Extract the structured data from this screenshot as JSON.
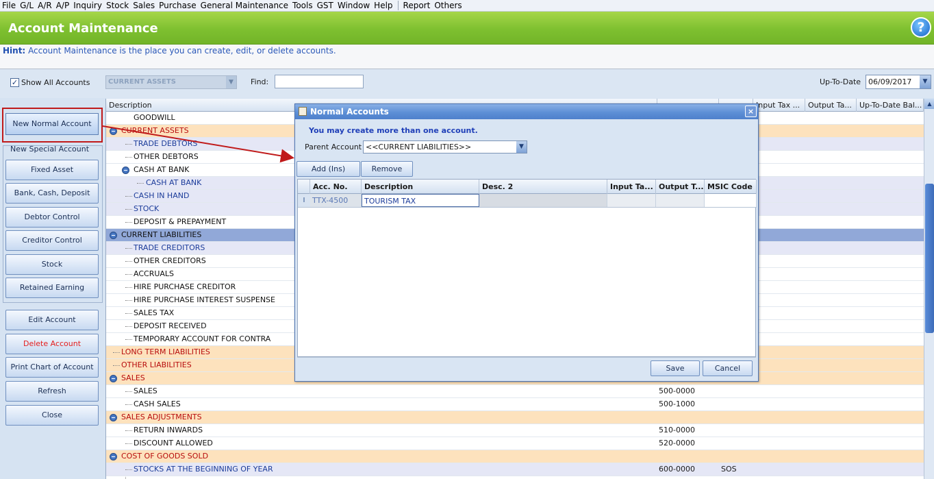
{
  "menu": [
    "File",
    "G/L",
    "A/R",
    "A/P",
    "Inquiry",
    "Stock",
    "Sales",
    "Purchase",
    "General Maintenance",
    "Tools",
    "GST",
    "Window",
    "Help",
    "Report",
    "Others"
  ],
  "header": {
    "title": "Account Maintenance",
    "help": "?"
  },
  "hint": {
    "label": "Hint:",
    "text": "Account Maintenance is the place you can create, edit, or delete accounts."
  },
  "filter": {
    "show_all_label": "Show All Accounts",
    "show_all_checked": "✓",
    "category_value": "CURRENT ASSETS",
    "find_label": "Find:",
    "find_value": "",
    "uptodate_label": "Up-To-Date",
    "uptodate_value": "06/09/2017"
  },
  "left_buttons": {
    "new_normal": "New Normal Account",
    "new_special": "New Special Account",
    "fixed_asset": "Fixed Asset",
    "bank_cash": "Bank, Cash, Deposit",
    "debtor_control": "Debtor Control",
    "creditor_control": "Creditor Control",
    "stock": "Stock",
    "retained_earning": "Retained Earning",
    "edit": "Edit Account",
    "delete": "Delete Account",
    "print": "Print Chart of Account",
    "refresh": "Refresh",
    "close": "Close"
  },
  "grid": {
    "headers": {
      "description": "Description",
      "input_tax": "Input Tax ...",
      "output_tax": "Output Ta...",
      "utd_balance": "Up-To-Date Bal..."
    },
    "rows": [
      {
        "text": "GOODWILL",
        "code": "",
        "msic": ""
      },
      {
        "text": "CURRENT ASSETS",
        "code": "",
        "msic": ""
      },
      {
        "text": "TRADE DEBTORS",
        "code": "",
        "msic": ""
      },
      {
        "text": "OTHER DEBTORS",
        "code": "",
        "msic": ""
      },
      {
        "text": "CASH AT BANK",
        "code": "",
        "msic": ""
      },
      {
        "text": "CASH AT BANK",
        "code": "",
        "msic": ""
      },
      {
        "text": "CASH IN HAND",
        "code": "",
        "msic": ""
      },
      {
        "text": "STOCK",
        "code": "",
        "msic": ""
      },
      {
        "text": "DEPOSIT & PREPAYMENT",
        "code": "",
        "msic": ""
      },
      {
        "text": "CURRENT LIABILITIES",
        "code": "",
        "msic": ""
      },
      {
        "text": "TRADE CREDITORS",
        "code": "",
        "msic": ""
      },
      {
        "text": "OTHER CREDITORS",
        "code": "",
        "msic": ""
      },
      {
        "text": "ACCRUALS",
        "code": "",
        "msic": ""
      },
      {
        "text": "HIRE PURCHASE CREDITOR",
        "code": "",
        "msic": ""
      },
      {
        "text": "HIRE PURCHASE INTEREST SUSPENSE",
        "code": "",
        "msic": ""
      },
      {
        "text": "SALES TAX",
        "code": "",
        "msic": ""
      },
      {
        "text": "DEPOSIT RECEIVED",
        "code": "",
        "msic": ""
      },
      {
        "text": "TEMPORARY ACCOUNT FOR CONTRA",
        "code": "",
        "msic": ""
      },
      {
        "text": "LONG TERM LIABILITIES",
        "code": "",
        "msic": ""
      },
      {
        "text": "OTHER LIABILITIES",
        "code": "",
        "msic": ""
      },
      {
        "text": "SALES",
        "code": "",
        "msic": ""
      },
      {
        "text": "SALES",
        "code": "500-0000",
        "msic": ""
      },
      {
        "text": "CASH SALES",
        "code": "500-1000",
        "msic": ""
      },
      {
        "text": "SALES ADJUSTMENTS",
        "code": "",
        "msic": ""
      },
      {
        "text": "RETURN INWARDS",
        "code": "510-0000",
        "msic": ""
      },
      {
        "text": "DISCOUNT ALLOWED",
        "code": "520-0000",
        "msic": ""
      },
      {
        "text": "COST OF GOODS SOLD",
        "code": "",
        "msic": ""
      },
      {
        "text": "STOCKS AT THE BEGINNING OF YEAR",
        "code": "600-0000",
        "msic": "SOS"
      }
    ]
  },
  "dialog": {
    "title": "Normal Accounts",
    "close": "×",
    "hint": "You may create more than one account.",
    "parent_label": "Parent Account",
    "parent_value": "<<CURRENT LIABILITIES>>",
    "add_label": "Add  (Ins)",
    "remove_label": "Remove",
    "columns": {
      "acc_no": "Acc. No.",
      "description": "Description",
      "desc2": "Desc. 2",
      "input_tax": "Input Ta...",
      "output_tax": "Output T...",
      "msic": "MSIC Code"
    },
    "row": {
      "indicator": "I",
      "acc_no": "TTX-4500",
      "description": "TOURISM TAX",
      "desc2": "",
      "input_tax": "",
      "output_tax": "",
      "msic": ""
    },
    "save_label": "Save",
    "cancel_label": "Cancel"
  },
  "colors": {
    "title_green": "#7ec030",
    "annotation_red": "#c01a1a",
    "category_row": "#fde2bd",
    "selected_row": "#91a8d8"
  }
}
